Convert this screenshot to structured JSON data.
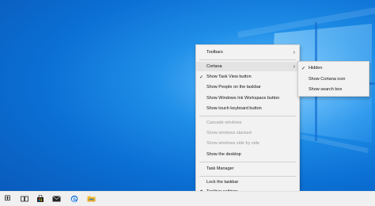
{
  "context_menu": {
    "items": [
      {
        "label": "Toolbars"
      },
      {
        "label": "Cortana"
      },
      {
        "label": "Show Task View button"
      },
      {
        "label": "Show People on the taskbar"
      },
      {
        "label": "Show Windows Ink Workspace button"
      },
      {
        "label": "Show touch keyboard button"
      },
      {
        "label": "Cascade windows"
      },
      {
        "label": "Show windows stacked"
      },
      {
        "label": "Show windows side by side"
      },
      {
        "label": "Show the desktop"
      },
      {
        "label": "Task Manager"
      },
      {
        "label": "Lock the taskbar"
      },
      {
        "label": "Taskbar settings"
      }
    ],
    "check_glyph": "✓",
    "arrow_glyph": "›",
    "settings_glyph": "⚙"
  },
  "cortana_submenu": {
    "items": [
      {
        "label": "Hidden"
      },
      {
        "label": "Show Cortana icon"
      },
      {
        "label": "Show search box"
      }
    ]
  },
  "taskbar": {
    "icons": [
      {
        "name": "windows-start-icon",
        "glyph": "⊞"
      },
      {
        "name": "task-view-icon",
        "glyph": "▭"
      },
      {
        "name": "store-icon",
        "glyph": "◼"
      },
      {
        "name": "mail-icon",
        "glyph": "✉"
      },
      {
        "name": "edge-icon",
        "glyph": "e"
      },
      {
        "name": "file-explorer-icon",
        "glyph": "▬"
      }
    ]
  },
  "colors": {
    "desktop": "#0b6fd3",
    "menu_bg": "#f2f2f2",
    "hover": "#e3e3e3",
    "disabled_text": "#9a9a9a"
  }
}
